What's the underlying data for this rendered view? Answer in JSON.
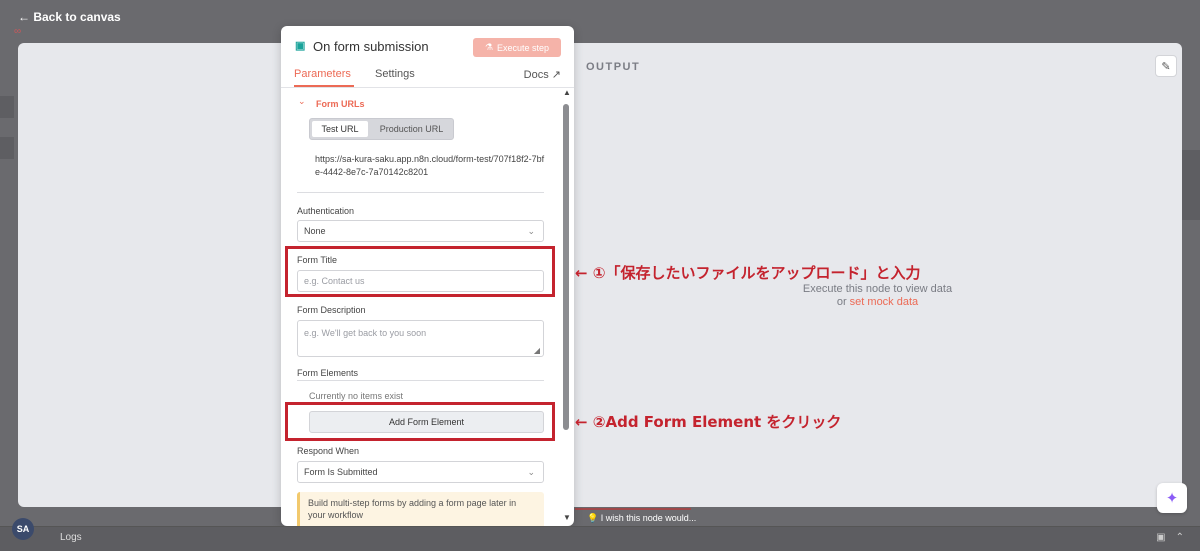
{
  "top": {
    "back_label": "← Back to canvas"
  },
  "panel": {
    "title": "On form submission",
    "execute_label": "Execute step",
    "tabs": [
      "Parameters",
      "Settings"
    ],
    "docs_label": "Docs ↗",
    "form_urls": {
      "section_label": "Form URLs",
      "tabs": [
        "Test URL",
        "Production URL"
      ],
      "url": "https://sa-kura-saku.app.n8n.cloud/form-test/707f18f2-7bfe-4442-8e7c-7a70142c8201"
    },
    "authentication": {
      "label": "Authentication",
      "value": "None"
    },
    "form_title": {
      "label": "Form Title",
      "placeholder": "e.g. Contact us"
    },
    "form_description": {
      "label": "Form Description",
      "placeholder": "e.g. We'll get back to you soon"
    },
    "form_elements": {
      "label": "Form Elements",
      "empty_text": "Currently no items exist",
      "add_label": "Add Form Element"
    },
    "respond_when": {
      "label": "Respond When",
      "value": "Form Is Submitted"
    },
    "hint": "Build multi-step forms by adding a form page later in your workflow"
  },
  "output": {
    "title": "OUTPUT",
    "empty_line1": "Execute this node to view data",
    "empty_prefix": "or ",
    "mock_link": "set mock data"
  },
  "annotations": {
    "step1": "← ①「保存したいファイルをアップロード」と入力",
    "step2": "← ②Add Form Element をクリック"
  },
  "bottom": {
    "logs_label": "Logs",
    "avatar_initials": "SA",
    "wish_label": "💡  I wish this node would..."
  },
  "colors": {
    "accent": "#ec6a55",
    "highlight": "#c4232e",
    "node_icon": "#1aa39a"
  }
}
